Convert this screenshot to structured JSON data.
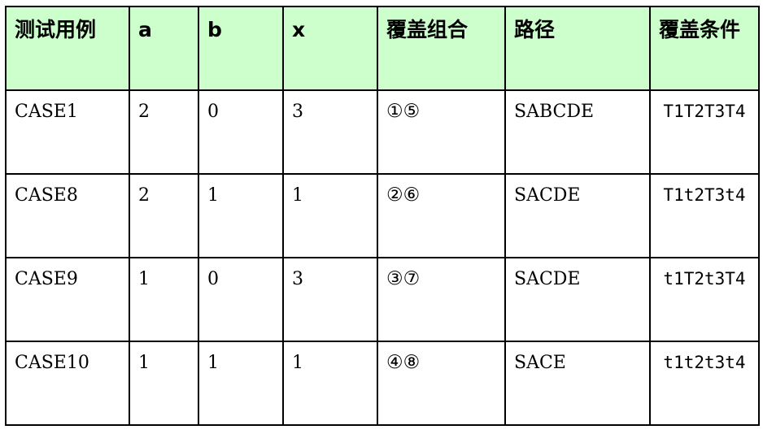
{
  "table": {
    "headers": [
      "测试用例",
      "a",
      "b",
      "x",
      "覆盖组合",
      "路径",
      "覆盖条件"
    ],
    "rows": [
      {
        "case": "CASE1",
        "a": "2",
        "b": "0",
        "x": "3",
        "combo": "①⑤",
        "path": "SABCDE",
        "cond": "T1T2T3T4"
      },
      {
        "case": "CASE8",
        "a": "2",
        "b": "1",
        "x": "1",
        "combo": "②⑥",
        "path": "SACDE",
        "cond": "T1t2T3t4"
      },
      {
        "case": "CASE9",
        "a": "1",
        "b": "0",
        "x": "3",
        "combo": "③⑦",
        "path": "SACDE",
        "cond": "t1T2t3T4"
      },
      {
        "case": "CASE10",
        "a": "1",
        "b": "1",
        "x": "1",
        "combo": "④⑧",
        "path": "SACE",
        "cond": "t1t2t3t4"
      }
    ]
  },
  "colors": {
    "header_bg": "#ccffcc",
    "border": "#000000"
  }
}
